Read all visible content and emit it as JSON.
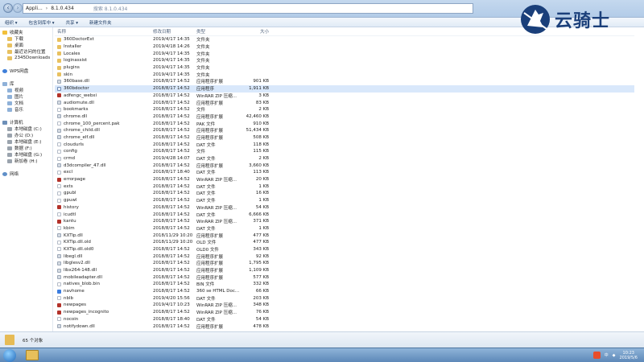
{
  "window": {
    "address_parts": [
      "Appli...",
      "8.1.0.434"
    ],
    "address_ghost": "搜索 8.1.0.434",
    "nav_back_icon": "back-arrow-icon",
    "nav_forward_icon": "forward-arrow-icon"
  },
  "toolbar": {
    "items": [
      "组织 ▾",
      "包含到库中 ▾",
      "共享 ▾",
      "新建文件夹"
    ]
  },
  "sidebar": {
    "groups": [
      {
        "items": [
          {
            "label": "收藏夹",
            "icon": "star-icon"
          },
          {
            "label": "下载",
            "icon": "folder-icon"
          },
          {
            "label": "桌面",
            "icon": "folder-icon"
          },
          {
            "label": "最近访问的位置",
            "icon": "folder-icon"
          },
          {
            "label": "2345Downloads",
            "icon": "folder-icon"
          }
        ]
      },
      {
        "items": [
          {
            "label": "WPS网盘",
            "icon": "cloud-icon"
          }
        ]
      },
      {
        "items": [
          {
            "label": "库",
            "icon": "library-icon"
          },
          {
            "label": "视频",
            "icon": "library-icon"
          },
          {
            "label": "图片",
            "icon": "library-icon"
          },
          {
            "label": "文档",
            "icon": "library-icon"
          },
          {
            "label": "音乐",
            "icon": "library-icon"
          }
        ]
      },
      {
        "items": [
          {
            "label": "计算机",
            "icon": "computer-icon"
          },
          {
            "label": "本地磁盘 (C:)",
            "icon": "drive-icon"
          },
          {
            "label": "办公 (D:)",
            "icon": "drive-icon"
          },
          {
            "label": "本地磁盘 (E:)",
            "icon": "drive-icon"
          },
          {
            "label": "数据 (F:)",
            "icon": "drive-icon"
          },
          {
            "label": "本地磁盘 (G:)",
            "icon": "drive-icon"
          },
          {
            "label": "新加卷 (H:)",
            "icon": "drive-icon"
          }
        ]
      },
      {
        "items": [
          {
            "label": "网络",
            "icon": "network-icon"
          }
        ]
      }
    ]
  },
  "columns": {
    "name": "名称",
    "date": "修改日期",
    "type": "类型",
    "size": "大小"
  },
  "files": [
    {
      "name": "360DoctorExt",
      "date": "2019/4/17 14:35",
      "type": "文件夹",
      "size": "",
      "kind": "folder"
    },
    {
      "name": "Installer",
      "date": "2019/4/18 14:26",
      "type": "文件夹",
      "size": "",
      "kind": "folder"
    },
    {
      "name": "Locales",
      "date": "2019/4/17 14:35",
      "type": "文件夹",
      "size": "",
      "kind": "folder"
    },
    {
      "name": "loginassist",
      "date": "2019/4/17 14:35",
      "type": "文件夹",
      "size": "",
      "kind": "folder"
    },
    {
      "name": "plugins",
      "date": "2019/4/17 14:35",
      "type": "文件夹",
      "size": "",
      "kind": "folder"
    },
    {
      "name": "skin",
      "date": "2019/4/17 14:35",
      "type": "文件夹",
      "size": "",
      "kind": "folder"
    },
    {
      "name": "360base.dll",
      "date": "2018/8/17 14:52",
      "type": "应用程序扩展",
      "size": "901 KB",
      "kind": "dll"
    },
    {
      "name": "360bdoctor",
      "date": "2018/8/17 14:52",
      "type": "应用程序",
      "size": "1,911 KB",
      "kind": "exe",
      "selected": true
    },
    {
      "name": "adfengc_webxi",
      "date": "2018/8/17 14:52",
      "type": "WinRAR ZIP 压缩...",
      "size": "3 KB",
      "kind": "zip"
    },
    {
      "name": "audiomute.dll",
      "date": "2018/8/17 14:52",
      "type": "应用程序扩展",
      "size": "83 KB",
      "kind": "dll"
    },
    {
      "name": "bookmarks",
      "date": "2018/8/17 14:52",
      "type": "文件",
      "size": "2 KB",
      "kind": "file"
    },
    {
      "name": "chrome.dll",
      "date": "2018/8/17 14:52",
      "type": "应用程序扩展",
      "size": "42,460 KB",
      "kind": "dll"
    },
    {
      "name": "chrome_100_percent.pak",
      "date": "2018/8/17 14:52",
      "type": "PAK 文件",
      "size": "910 KB",
      "kind": "file"
    },
    {
      "name": "chrome_child.dll",
      "date": "2018/8/17 14:52",
      "type": "应用程序扩展",
      "size": "51,434 KB",
      "kind": "dll"
    },
    {
      "name": "chrome_elf.dll",
      "date": "2018/8/17 14:52",
      "type": "应用程序扩展",
      "size": "508 KB",
      "kind": "dll"
    },
    {
      "name": "cloudurls",
      "date": "2018/8/17 14:52",
      "type": "DAT 文件",
      "size": "118 KB",
      "kind": "file"
    },
    {
      "name": "config",
      "date": "2018/8/17 14:52",
      "type": "文件",
      "size": "115 KB",
      "kind": "file"
    },
    {
      "name": "crmd",
      "date": "2019/4/28 14:07",
      "type": "DAT 文件",
      "size": "2 KB",
      "kind": "file"
    },
    {
      "name": "d3dcompiler_47.dll",
      "date": "2018/8/17 14:52",
      "type": "应用程序扩展",
      "size": "3,660 KB",
      "kind": "dll"
    },
    {
      "name": "excl",
      "date": "2018/8/17 18:40",
      "type": "DAT 文件",
      "size": "113 KB",
      "kind": "file"
    },
    {
      "name": "errorpage",
      "date": "2018/8/17 14:52",
      "type": "WinRAR ZIP 压缩...",
      "size": "20 KB",
      "kind": "zip"
    },
    {
      "name": "exts",
      "date": "2018/8/17 14:52",
      "type": "DAT 文件",
      "size": "1 KB",
      "kind": "file"
    },
    {
      "name": "gpubl",
      "date": "2018/8/17 14:52",
      "type": "DAT 文件",
      "size": "16 KB",
      "kind": "file"
    },
    {
      "name": "gpuwl",
      "date": "2018/8/17 14:52",
      "type": "DAT 文件",
      "size": "1 KB",
      "kind": "file"
    },
    {
      "name": "history",
      "date": "2018/8/17 14:52",
      "type": "WinRAR ZIP 压缩...",
      "size": "54 KB",
      "kind": "zip"
    },
    {
      "name": "icudtl",
      "date": "2018/8/17 14:52",
      "type": "DAT 文件",
      "size": "6,666 KB",
      "kind": "file"
    },
    {
      "name": "kantu",
      "date": "2018/8/17 14:52",
      "type": "WinRAR ZIP 压缩...",
      "size": "371 KB",
      "kind": "zip"
    },
    {
      "name": "kbim",
      "date": "2018/8/17 14:52",
      "type": "DAT 文件",
      "size": "1 KB",
      "kind": "file"
    },
    {
      "name": "KXTip.dll",
      "date": "2018/11/29 10:20",
      "type": "应用程序扩展",
      "size": "477 KB",
      "kind": "dll"
    },
    {
      "name": "KXTip.dll.old",
      "date": "2018/11/29 10:20",
      "type": "OLD 文件",
      "size": "477 KB",
      "kind": "file"
    },
    {
      "name": "KXTip.dll.old0",
      "date": "2018/8/17 14:52",
      "type": "OLD0 文件",
      "size": "343 KB",
      "kind": "file"
    },
    {
      "name": "libegl.dll",
      "date": "2018/8/17 14:52",
      "type": "应用程序扩展",
      "size": "92 KB",
      "kind": "dll"
    },
    {
      "name": "libglesv2.dll",
      "date": "2018/8/17 14:52",
      "type": "应用程序扩展",
      "size": "1,795 KB",
      "kind": "dll"
    },
    {
      "name": "libx264-148.dll",
      "date": "2018/8/17 14:52",
      "type": "应用程序扩展",
      "size": "1,109 KB",
      "kind": "dll"
    },
    {
      "name": "mobileadapter.dll",
      "date": "2018/8/17 14:52",
      "type": "应用程序扩展",
      "size": "577 KB",
      "kind": "dll"
    },
    {
      "name": "natives_blob.bin",
      "date": "2018/8/17 14:52",
      "type": "BIN 文件",
      "size": "332 KB",
      "kind": "file"
    },
    {
      "name": "navhome",
      "date": "2018/8/17 14:52",
      "type": "360 se HTML Doc...",
      "size": "66 KB",
      "kind": "html"
    },
    {
      "name": "nblb",
      "date": "2019/4/20 15:56",
      "type": "DAT 文件",
      "size": "203 KB",
      "kind": "file"
    },
    {
      "name": "newpages",
      "date": "2019/4/17 10:23",
      "type": "WinRAR ZIP 压缩...",
      "size": "348 KB",
      "kind": "zip"
    },
    {
      "name": "newpages_incognito",
      "date": "2018/8/17 14:52",
      "type": "WinRAR ZIP 压缩...",
      "size": "76 KB",
      "kind": "zip"
    },
    {
      "name": "nocoin",
      "date": "2018/8/17 18:40",
      "type": "DAT 文件",
      "size": "54 KB",
      "kind": "file"
    },
    {
      "name": "notifydown.dll",
      "date": "2018/8/17 14:52",
      "type": "应用程序扩展",
      "size": "478 KB",
      "kind": "dll"
    }
  ],
  "status": {
    "count_text": "65 个对象"
  },
  "watermark": {
    "text": "云骑士"
  },
  "taskbar": {
    "start_icon": "windows-start-icon",
    "tray_text": "中",
    "time": "10:23",
    "date": "2019/5/6"
  }
}
